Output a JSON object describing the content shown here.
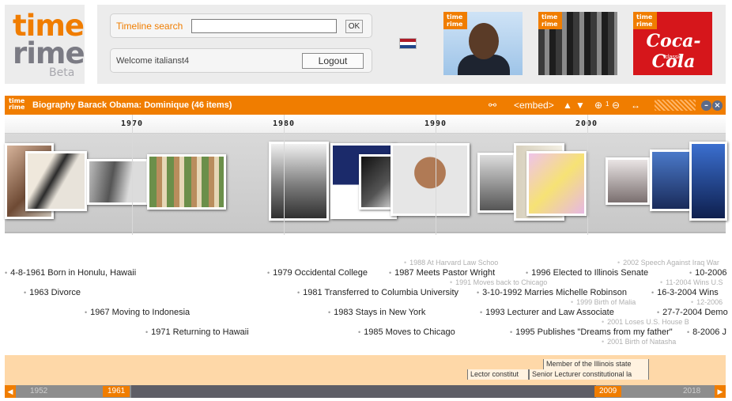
{
  "logo": {
    "line1": "time",
    "line2": "rime",
    "beta": "Beta"
  },
  "search": {
    "label": "Timeline search",
    "value": "",
    "ok_label": "OK"
  },
  "user": {
    "welcome": "Welcome italianst4",
    "logout_label": "Logout"
  },
  "flag_colors": [
    "#ae1c28",
    "#ffffff",
    "#21468b"
  ],
  "featured": [
    {
      "badge": "time rime",
      "name": "obama-thumb"
    },
    {
      "badge": "time rime",
      "name": "supremes-thumb"
    },
    {
      "badge": "time rime",
      "name": "coca-cola-thumb",
      "text": "Coca-Cola",
      "sub": "classic"
    }
  ],
  "timeline": {
    "badge": "time rime",
    "title": "Biography Barack Obama: Dominique  (46 items)",
    "embed_label": "<embed>",
    "zoom_level": "1",
    "years": [
      "1970",
      "1980",
      "1990",
      "2000"
    ],
    "events": [
      "4-8-1961 Born in Honulu, Hawaii",
      "1963 Divorce",
      "1967 Moving to Indonesia",
      "1971 Returning to Hawaii",
      "1979 Occidental College",
      "1981 Transferred to Columbia University",
      "1983 Stays in New York",
      "1985 Moves to Chicago",
      "1987 Meets Pastor Wright",
      "1988 At Harvard Law Schoo",
      "1991 Moves back to Chicago",
      "3-10-1992 Marries Michelle Robinson",
      "1993 Lecturer and Law Associate",
      "1995 Publishes \"Dreams from my father\"",
      "1996 Elected to Illinois Senate",
      "1999 Birth of Malia",
      "2001 Loses U.S. House B",
      "2001 Birth of Natasha",
      "2002 Speech Against Iraq War",
      "10-2006",
      "11-2004 Wins U.S",
      "16-3-2004 Wins",
      "12-2006",
      "27-7-2004 Demo",
      "8-2006 J"
    ],
    "periods": [
      "Member of the Illinois state",
      "Lector constitut",
      "Senior Lecturer constitutional la"
    ],
    "scale": {
      "start_label": "1952",
      "end_label": "2018",
      "range_start": "1961",
      "range_end": "2009"
    }
  },
  "accent_color": "#f07d00"
}
